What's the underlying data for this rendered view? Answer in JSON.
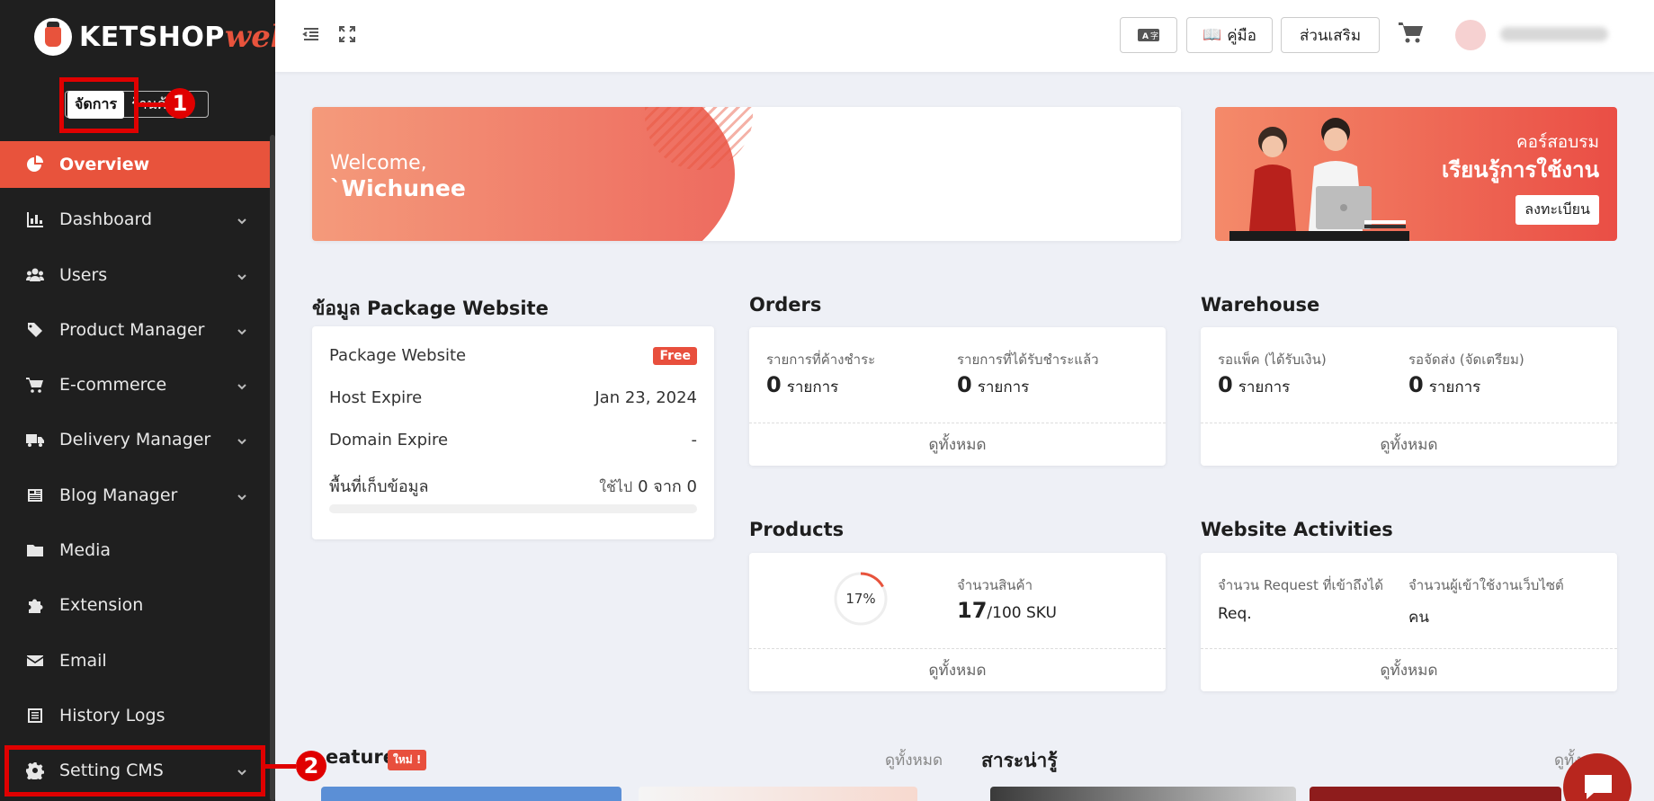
{
  "brand": {
    "name": "KETSHOP",
    "suffix": "web"
  },
  "mode_switch": {
    "active": "จัดการ",
    "other": "ร้านค้า"
  },
  "annotations": {
    "step1": "1",
    "step2": "2"
  },
  "sidebar": {
    "items": [
      {
        "label": "Overview",
        "icon": "chart-pie-icon",
        "active": true
      },
      {
        "label": "Dashboard",
        "icon": "chart-bar-icon",
        "dropdown": true
      },
      {
        "label": "Users",
        "icon": "users-icon",
        "dropdown": true
      },
      {
        "label": "Product Manager",
        "icon": "tags-icon",
        "dropdown": true
      },
      {
        "label": "E-commerce",
        "icon": "cart-icon",
        "dropdown": true
      },
      {
        "label": "Delivery Manager",
        "icon": "truck-icon",
        "dropdown": true
      },
      {
        "label": "Blog Manager",
        "icon": "newspaper-icon",
        "dropdown": true
      },
      {
        "label": "Media",
        "icon": "folder-icon"
      },
      {
        "label": "Extension",
        "icon": "puzzle-icon"
      },
      {
        "label": "Email",
        "icon": "envelope-icon"
      },
      {
        "label": "History Logs",
        "icon": "list-icon"
      },
      {
        "label": "Setting CMS",
        "icon": "gear-icon",
        "dropdown": true
      }
    ]
  },
  "topbar": {
    "translate_icon": "translate-icon",
    "manual_label": "คู่มือ",
    "addon_label": "ส่วนเสริม"
  },
  "welcome": {
    "line1": "Welcome,",
    "line2": "`Wichunee"
  },
  "course_banner": {
    "line1": "คอร์สอบรม",
    "line2": "เรียนรู้การใช้งาน",
    "button": "ลงทะเบียน"
  },
  "package": {
    "title": "ข้อมูล Package Website",
    "rows": [
      {
        "label": "Package Website",
        "badge": "Free"
      },
      {
        "label": "Host Expire",
        "value": "Jan 23, 2024"
      },
      {
        "label": "Domain Expire",
        "value": "-"
      },
      {
        "label": "พื้นที่เก็บข้อมูล",
        "value_prefix": "ใช้ไป",
        "value": "0 จาก 0"
      }
    ]
  },
  "orders": {
    "title": "Orders",
    "left_label": "รายการที่ค้างชำระ",
    "left_value": "0",
    "left_unit": "รายการ",
    "right_label": "รายการที่ได้รับชำระแล้ว",
    "right_value": "0",
    "right_unit": "รายการ",
    "footer": "ดูทั้งหมด"
  },
  "warehouse": {
    "title": "Warehouse",
    "left_label": "รอแพ็ค (ได้รับเงิน)",
    "left_value": "0",
    "left_unit": "รายการ",
    "right_label": "รอจัดส่ง (จัดเตรียม)",
    "right_value": "0",
    "right_unit": "รายการ",
    "footer": "ดูทั้งหมด"
  },
  "products": {
    "title": "Products",
    "percent": "17%",
    "percent_value": 0.17,
    "count_label": "จำนวนสินค้า",
    "count": "17",
    "count_suffix": "/100 SKU",
    "footer": "ดูทั้งหมด"
  },
  "activities": {
    "title": "Website Activities",
    "left_label": "จำนวน Request ที่เข้าถึงได้",
    "left_value": "Req.",
    "right_label": "จำนวนผู้เข้าใช้งานเว็บไซต์",
    "right_value": "คน",
    "footer": "ดูทั้งหมด"
  },
  "feature": {
    "title": "eature",
    "badge": "ใหม่ !",
    "more": "ดูทั้งหมด"
  },
  "knowledge": {
    "title": "สาระน่ารู้",
    "more": "ดูทั้ง"
  },
  "colors": {
    "accent": "#e8533c",
    "sidebar_bg": "#1f1f1f",
    "highlight": "#e00000",
    "page_bg": "#eef0f6"
  }
}
